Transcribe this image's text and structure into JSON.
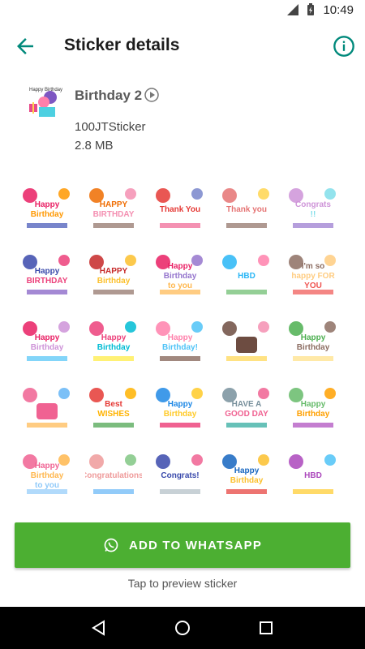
{
  "status_bar": {
    "time": "10:49"
  },
  "app_bar": {
    "title": "Sticker details",
    "back_icon": "arrow-back-icon",
    "info_icon": "info-icon"
  },
  "pack": {
    "name": "Birthday 2",
    "publisher": "100JTSticker",
    "size": "2.8 MB",
    "tray_icon": "sticker-tray-icon",
    "play_icon": "play-icon"
  },
  "stickers": [
    {
      "text": "Happy Birthday"
    },
    {
      "text": "HAPPY BIRTHDAY"
    },
    {
      "text": "Thank You"
    },
    {
      "text": "Thank you"
    },
    {
      "text": "Congrats !!"
    },
    {
      "text": "Happy BIRTHDAY"
    },
    {
      "text": "HAPPY Birthday"
    },
    {
      "text": "Happy Birthday to you"
    },
    {
      "text": "HBD"
    },
    {
      "text": "I'm so happy FOR YOU"
    },
    {
      "text": "Happy Birthday"
    },
    {
      "text": "Happy Birthday"
    },
    {
      "text": "Happy Birthday!"
    },
    {
      "text": ""
    },
    {
      "text": "Happy Birthday"
    },
    {
      "text": ""
    },
    {
      "text": "Best WISHES"
    },
    {
      "text": "Happy Birthday"
    },
    {
      "text": "HAVE A GOOD DAY"
    },
    {
      "text": "Happy Birthday"
    },
    {
      "text": "Happy Birthday to you"
    },
    {
      "text": "Congratulations!"
    },
    {
      "text": "Congrats!"
    },
    {
      "text": "Happy Birthday"
    },
    {
      "text": "HBD"
    }
  ],
  "actions": {
    "add_label": "ADD TO WHATSAPP",
    "hint": "Tap to preview sticker"
  },
  "colors": {
    "accent": "#00897b",
    "button": "#4caf32"
  }
}
